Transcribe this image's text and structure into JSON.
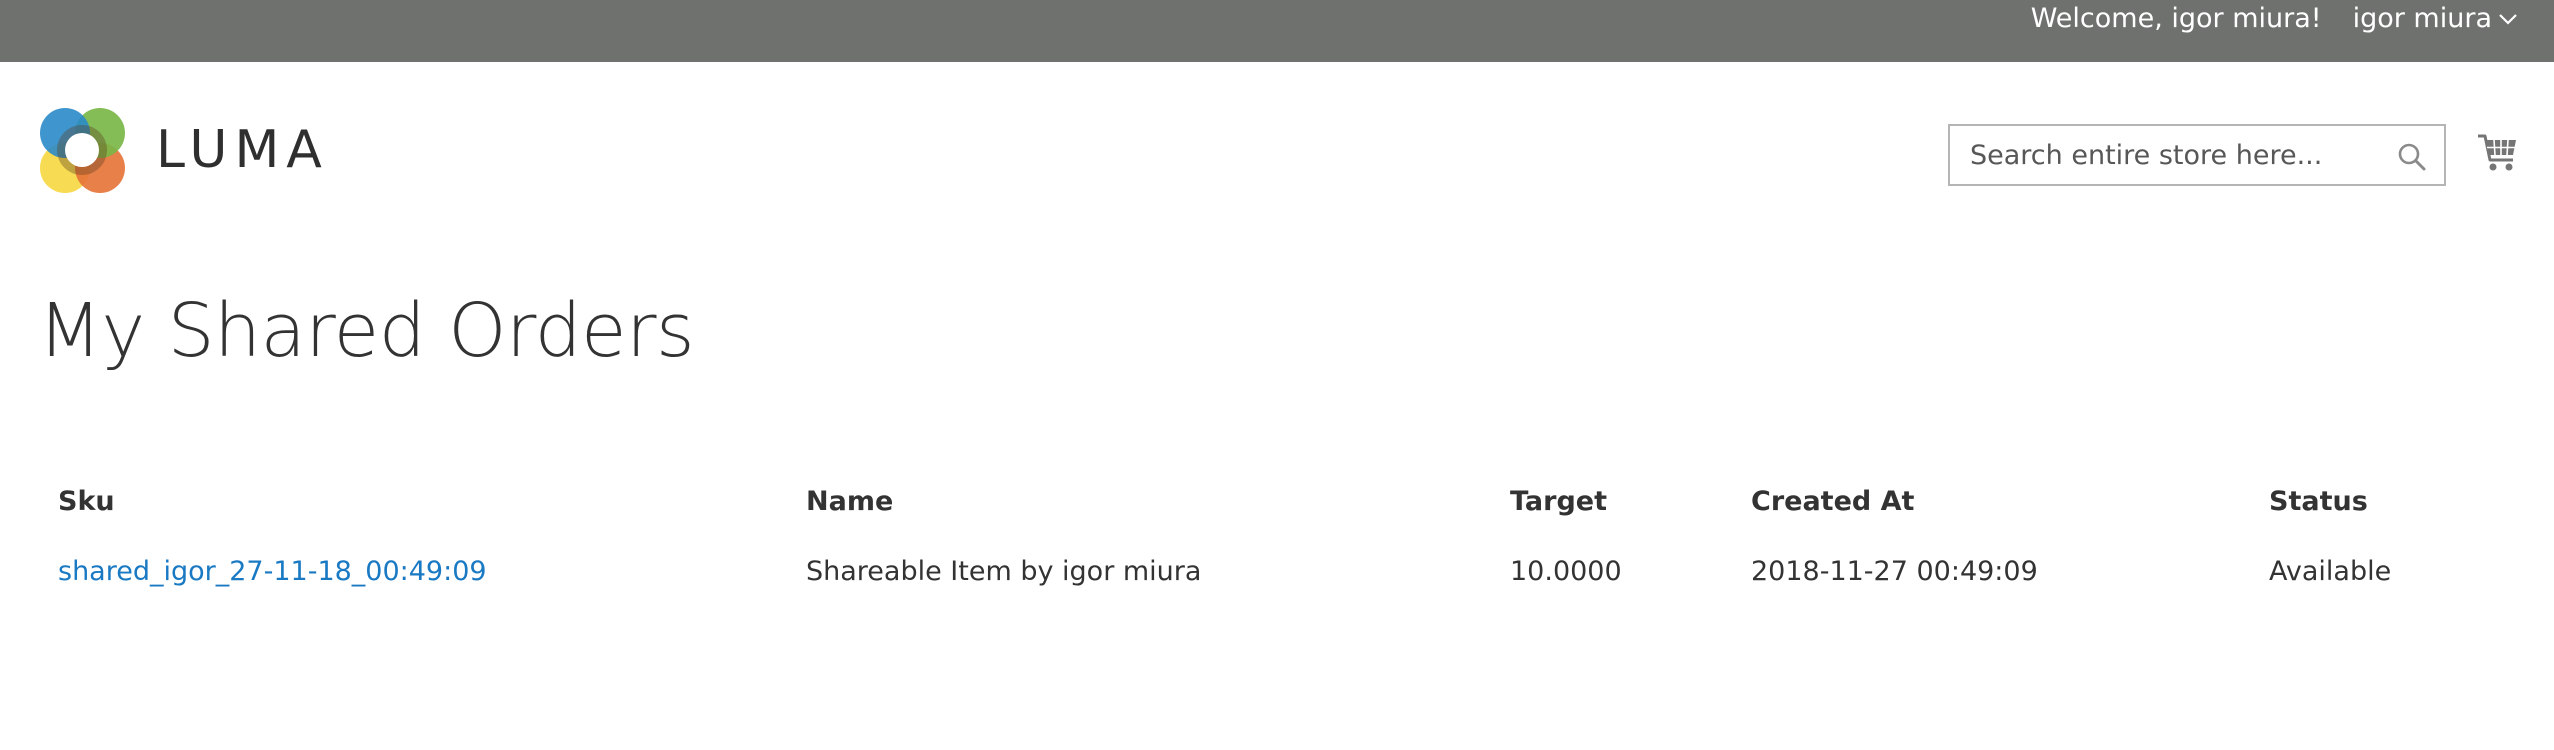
{
  "topbar": {
    "welcome_text": "Welcome, igor miura!",
    "account_label": "igor miura"
  },
  "header": {
    "logo_text": "LUMA",
    "search_placeholder": "Search entire store here..."
  },
  "page": {
    "title": "My Shared Orders"
  },
  "table": {
    "headers": {
      "sku": "Sku",
      "name": "Name",
      "target": "Target",
      "created_at": "Created At",
      "status": "Status"
    },
    "rows": [
      {
        "sku": "shared_igor_27-11-18_00:49:09",
        "name": "Shareable Item by igor miura",
        "target": "10.0000",
        "created_at": "2018-11-27 00:49:09",
        "status": "Available"
      }
    ]
  },
  "icons": {
    "account_menu": "chevron-down-icon",
    "search": "search-icon",
    "cart": "cart-icon"
  },
  "colors": {
    "topbar_bg": "#6e716e",
    "link": "#1979c3",
    "text": "#333333"
  }
}
